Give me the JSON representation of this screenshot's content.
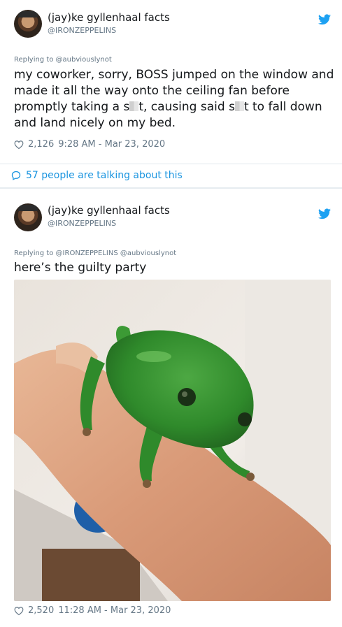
{
  "tweet1": {
    "author_name": "(jay)ke gyllenhaal facts",
    "author_handle": "@IRONZEPPELINS",
    "replying_to": "Replying to @aubviouslynot",
    "text_part1": "my coworker, sorry, BOSS jumped on the window and made it all the way onto the ceiling fan before promptly taking a s",
    "text_part2": "t, causing said s",
    "text_part3": "t to fall down and land nicely on my bed.",
    "likes": "2,126",
    "timestamp": "9:28 AM - Mar 23, 2020",
    "talking_link": "57 people are talking about this"
  },
  "tweet2": {
    "author_name": "(jay)ke gyllenhaal facts",
    "author_handle": "@IRONZEPPELINS",
    "replying_to": "Replying to @IRONZEPPELINS @aubviouslynot",
    "text": "here’s the guilty party",
    "likes": "2,520",
    "timestamp": "11:28 AM - Mar 23, 2020"
  },
  "icons": {
    "bird": "twitter-bird-icon",
    "heart": "heart-icon",
    "bubble": "speech-bubble-icon"
  },
  "colors": {
    "twitter_blue": "#1da1f2",
    "link_blue": "#1b95e0",
    "secondary_text": "#657786",
    "frog_green": "#2f8a2b"
  }
}
